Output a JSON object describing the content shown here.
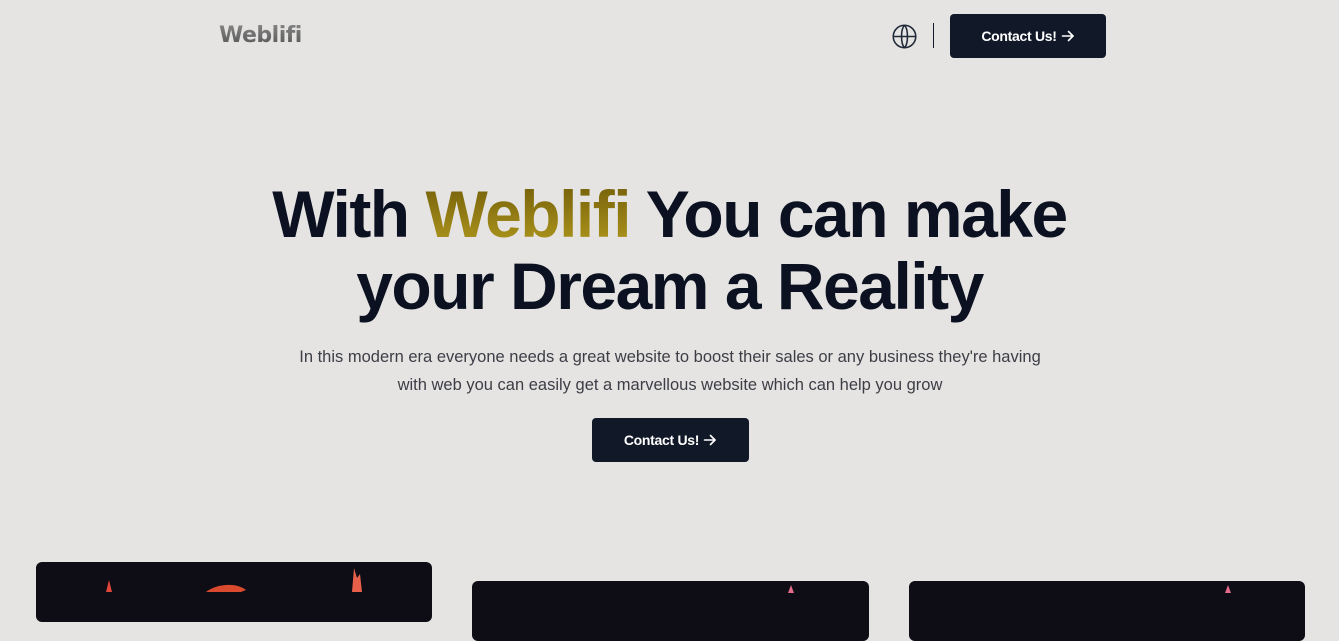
{
  "navbar": {
    "logo": "Weblifi",
    "globe_icon": "globe-icon",
    "contact_label": "Contact Us!",
    "arrow_icon": "arrow-right-icon"
  },
  "hero": {
    "title_part1": "With",
    "title_brand": "Weblifi",
    "title_part2": "You can make",
    "title_line2": "your Dream a Reality",
    "description": "In this modern era everyone needs a great website to boost their sales or any business they're having with web you can easily get a marvellous website which can help you grow",
    "contact_label": "Contact Us!"
  },
  "colors": {
    "background": "#e5e4e3",
    "button": "#111827",
    "brand_gold": "#8f7712",
    "heading": "#0b1120",
    "card": "#0e0d15"
  }
}
